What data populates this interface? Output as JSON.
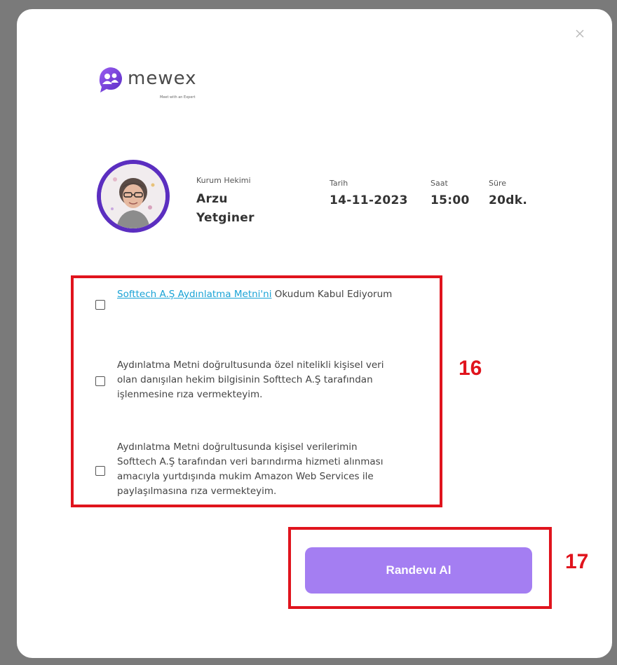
{
  "brand": {
    "name": "mewex",
    "tagline": "Meet with an Expert",
    "accent_color": "#7b4ae2"
  },
  "icons": {
    "close": "close-icon",
    "logo": "mewex-logo-icon",
    "checkbox": "checkbox"
  },
  "appointment": {
    "expert_role_label": "Kurum Hekimi",
    "expert_first_name": "Arzu",
    "expert_last_name": "Yetginer",
    "date_label": "Tarih",
    "date_value": "14-11-2023",
    "time_label": "Saat",
    "time_value": "15:00",
    "duration_label": "Süre",
    "duration_value": "20dk."
  },
  "consents": [
    {
      "link_text": "Softtech A.Ş Aydınlatma Metni'ni",
      "text_after_link": " Okudum Kabul Ediyorum",
      "checked": false
    },
    {
      "text": "Aydınlatma Metni doğrultusunda özel nitelikli kişisel veri olan danışılan hekim bilgisinin Softtech A.Ş tarafından işlenmesine rıza vermekteyim.",
      "checked": false
    },
    {
      "text": "Aydınlatma Metni doğrultusunda kişisel verilerimin Softtech A.Ş tarafından veri barındırma hizmeti alınması amacıyla yurtdışında mukim Amazon Web Services ile paylaşılmasına rıza vermekteyim.",
      "checked": false
    }
  ],
  "submit_label": "Randevu Al",
  "submit_color": "#a47ef2",
  "annotations": {
    "consents_marker": "16",
    "button_marker": "17",
    "marker_color": "#e0141d"
  }
}
